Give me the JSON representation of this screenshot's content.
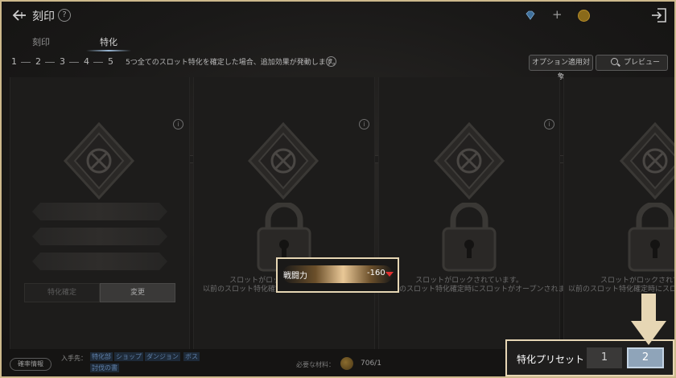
{
  "header": {
    "title": "刻印",
    "help": "?"
  },
  "tabs": [
    {
      "label": "刻印"
    },
    {
      "label": "特化"
    }
  ],
  "steps": {
    "numbers": [
      "1",
      "2",
      "3",
      "4",
      "5"
    ],
    "description": "5つ全てのスロット特化を確定した場合、追加効果が発動します。",
    "info": "i"
  },
  "buttons": {
    "option_target": "オプション適用対象",
    "preview": "プレビュー",
    "fix": "特化確定",
    "change": "変更"
  },
  "panels": [
    {
      "locked_line1": "",
      "locked_line2": ""
    },
    {
      "locked_line1": "スロットがロックされています。",
      "locked_line2": "以前のスロット特化確定時にスロットがオープンされます。"
    },
    {
      "locked_line1": "スロットがロックされています。",
      "locked_line2": "以前のスロット特化確定時にスロットがオープンされます。"
    },
    {
      "locked_line1": "スロットがロックされていま",
      "locked_line2": "以前のスロット特化確定時にスロットが"
    }
  ],
  "power": {
    "label": "戦闘力",
    "value": "-160"
  },
  "bottom": {
    "probability": "確率情報",
    "source_label": "入手先：",
    "sources": [
      "特化部",
      "ショップ",
      "ダンジョン",
      "ボス",
      "討伐の書"
    ],
    "material_label": "必要な材料：",
    "material_count": "706/1"
  },
  "preset": {
    "label": "特化プリセット",
    "option1": "1",
    "option2": "2",
    "selected": "2"
  },
  "colors": {
    "highlight_border": "#e6d6b4",
    "selected_preset": "#8fa4b9",
    "down_arrow": "#e23030"
  }
}
